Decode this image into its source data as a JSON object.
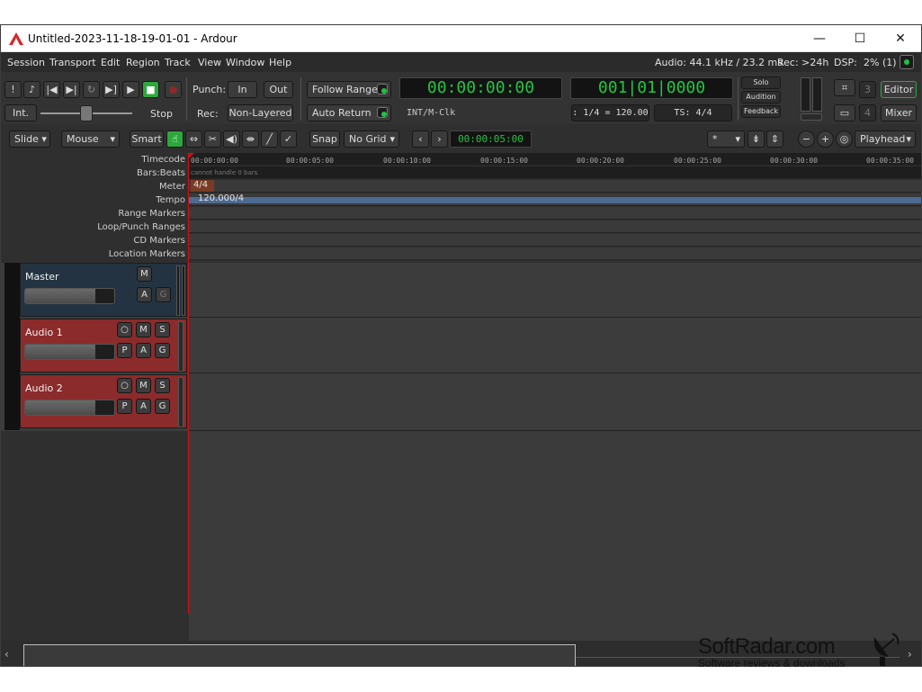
{
  "window": {
    "title": "Untitled-2023-11-18-19-01-01 - Ardour",
    "minimize_glyph": "—",
    "maximize_glyph": "☐",
    "close_glyph": "✕"
  },
  "menu": {
    "items": [
      "Session",
      "Transport",
      "Edit",
      "Region",
      "Track",
      "View",
      "Window",
      "Help"
    ],
    "audio_status": "Audio: 44.1 kHz / 23.2 ms",
    "rec_status": "Rec: >24h",
    "dsp_label": "DSP:",
    "dsp_value": "2% (1)"
  },
  "toolbar": {
    "transport_icons": [
      "!",
      "metronome",
      "|◀",
      "▶|",
      "↻",
      "▶]",
      "▶",
      "■",
      "●"
    ],
    "int_label": "Int.",
    "stop_label": "Stop",
    "punch_label": "Punch:",
    "punch_in": "In",
    "punch_out": "Out",
    "rec_label": "Rec:",
    "rec_mode": "Non-Layered",
    "follow_range": "Follow Range",
    "auto_return": "Auto Return",
    "primary_clock": "00:00:00:00",
    "primary_clock_sub": "INT/M-Clk",
    "secondary_clock": "001|01|0000",
    "tempo_readout": ": 1/4 = 120.00",
    "ts_readout": "TS: 4/4",
    "solo_label": "Solo",
    "audition_label": "Audition",
    "feedback_label": "Feedback",
    "num3": "3",
    "num4": "4",
    "editor_btn": "Editor",
    "mixer_btn": "Mixer"
  },
  "editbar": {
    "edit_mode": "Slide",
    "ripple_mode": "Mouse",
    "smart": "Smart",
    "snap": "Snap",
    "grid": "No Grid",
    "nudge_clock": "00:00:05:00",
    "zoom_focus": "*",
    "playhead": "Playhead"
  },
  "rulers": {
    "labels": [
      "Timecode",
      "Bars:Beats",
      "Meter",
      "Tempo",
      "Range Markers",
      "Loop/Punch Ranges",
      "CD Markers",
      "Location Markers"
    ],
    "ticks": [
      "00:00:00:00",
      "00:00:05:00",
      "00:00:10:00",
      "00:00:15:00",
      "00:00:20:00",
      "00:00:25:00",
      "00:00:30:00",
      "00:00:35:00"
    ],
    "bars_note": "cannot handle 0 bars",
    "meter_marker": "4/4",
    "tempo_marker": "120.000/4"
  },
  "tracks": [
    {
      "name": "Master",
      "buttons": [
        "M",
        "A",
        "G"
      ]
    },
    {
      "name": "Audio  1",
      "buttons": [
        "○",
        "M",
        "S",
        "P",
        "A",
        "G"
      ]
    },
    {
      "name": "Audio  2",
      "buttons": [
        "○",
        "M",
        "S",
        "P",
        "A",
        "G"
      ]
    }
  ],
  "watermark": {
    "brand": "SoftRadar.com",
    "tagline": "Software reviews & downloads"
  },
  "colors": {
    "clock_green": "#22c641",
    "audio_track_red": "#8c2b2b",
    "master_track": "#233341",
    "playhead_red": "#d01010"
  }
}
